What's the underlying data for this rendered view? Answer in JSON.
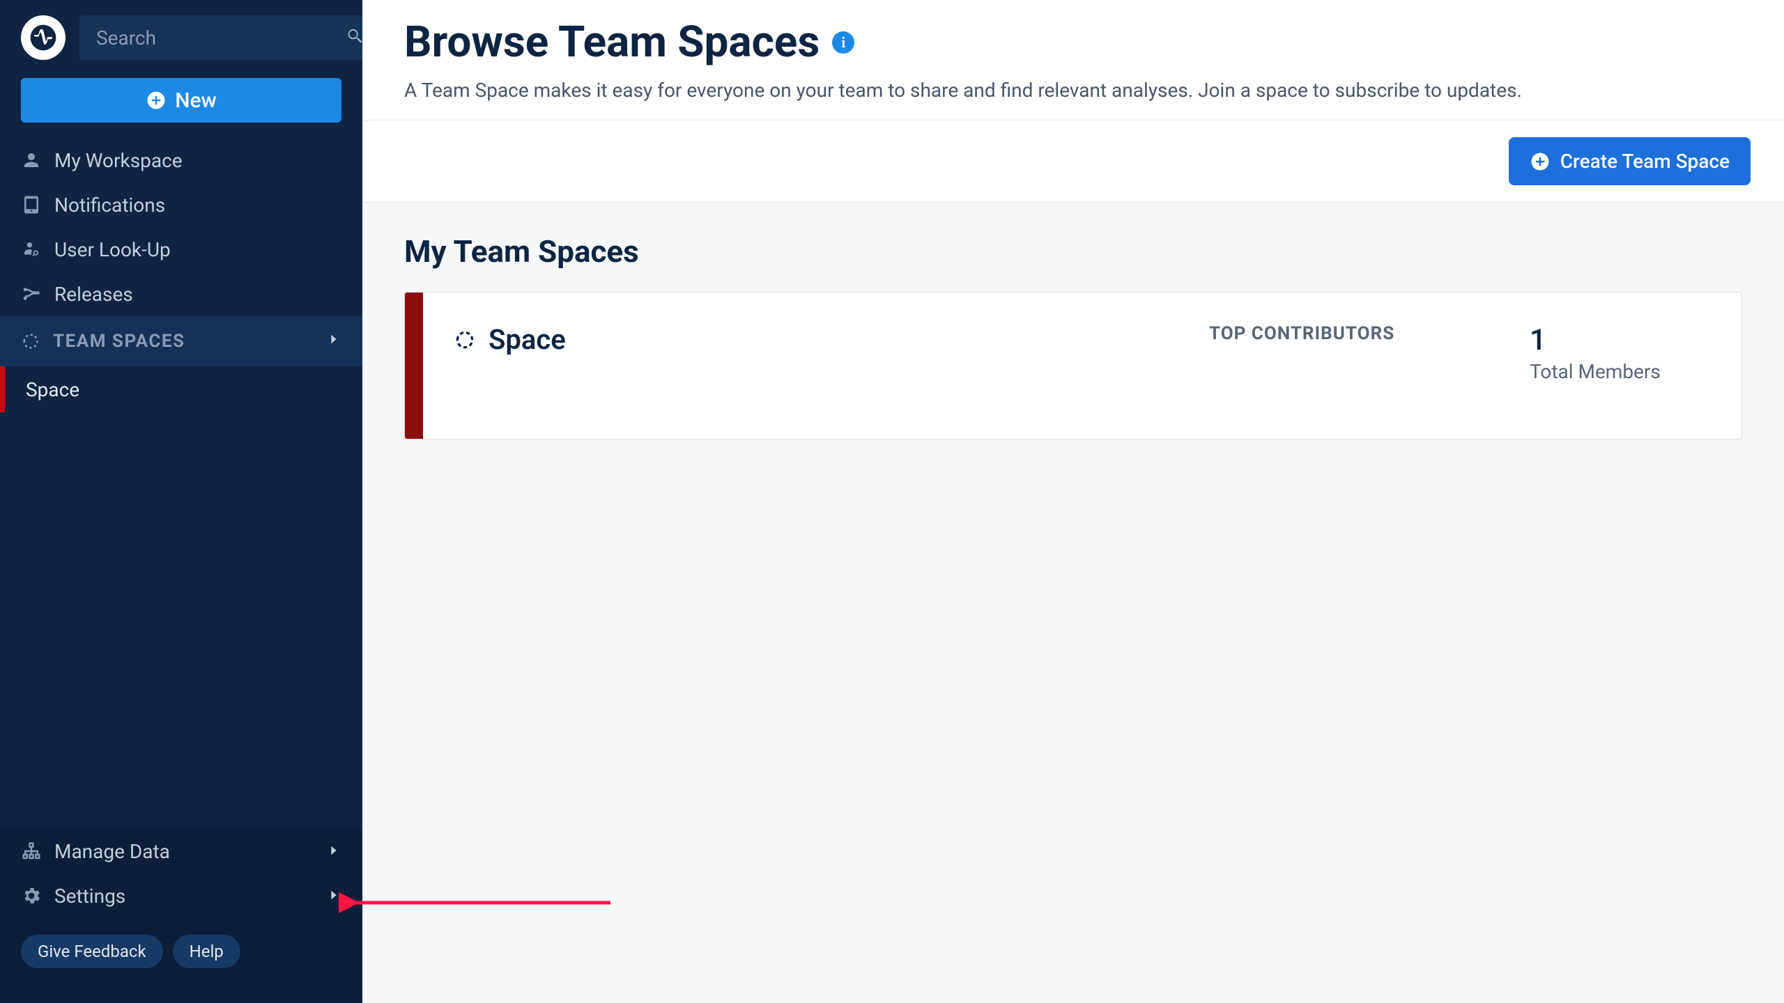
{
  "search": {
    "placeholder": "Search"
  },
  "new_button": {
    "label": "New"
  },
  "sidebar": {
    "items": [
      {
        "label": "My Workspace"
      },
      {
        "label": "Notifications"
      },
      {
        "label": "User Look-Up"
      },
      {
        "label": "Releases"
      }
    ],
    "section": {
      "label": "TEAM SPACES"
    },
    "sub_item": {
      "label": "Space"
    },
    "bottom": [
      {
        "label": "Manage Data"
      },
      {
        "label": "Settings"
      }
    ],
    "pills": [
      {
        "label": "Give Feedback"
      },
      {
        "label": "Help"
      }
    ]
  },
  "page": {
    "title": "Browse Team Spaces",
    "subtitle": "A Team Space makes it easy for everyone on your team to share and find relevant analyses. Join a space to subscribe to updates."
  },
  "toolbar": {
    "create_label": "Create Team Space"
  },
  "content": {
    "section_title": "My Team Spaces",
    "space": {
      "name": "Space",
      "contrib_label": "TOP CONTRIBUTORS",
      "member_count": "1",
      "member_label": "Total Members"
    }
  }
}
